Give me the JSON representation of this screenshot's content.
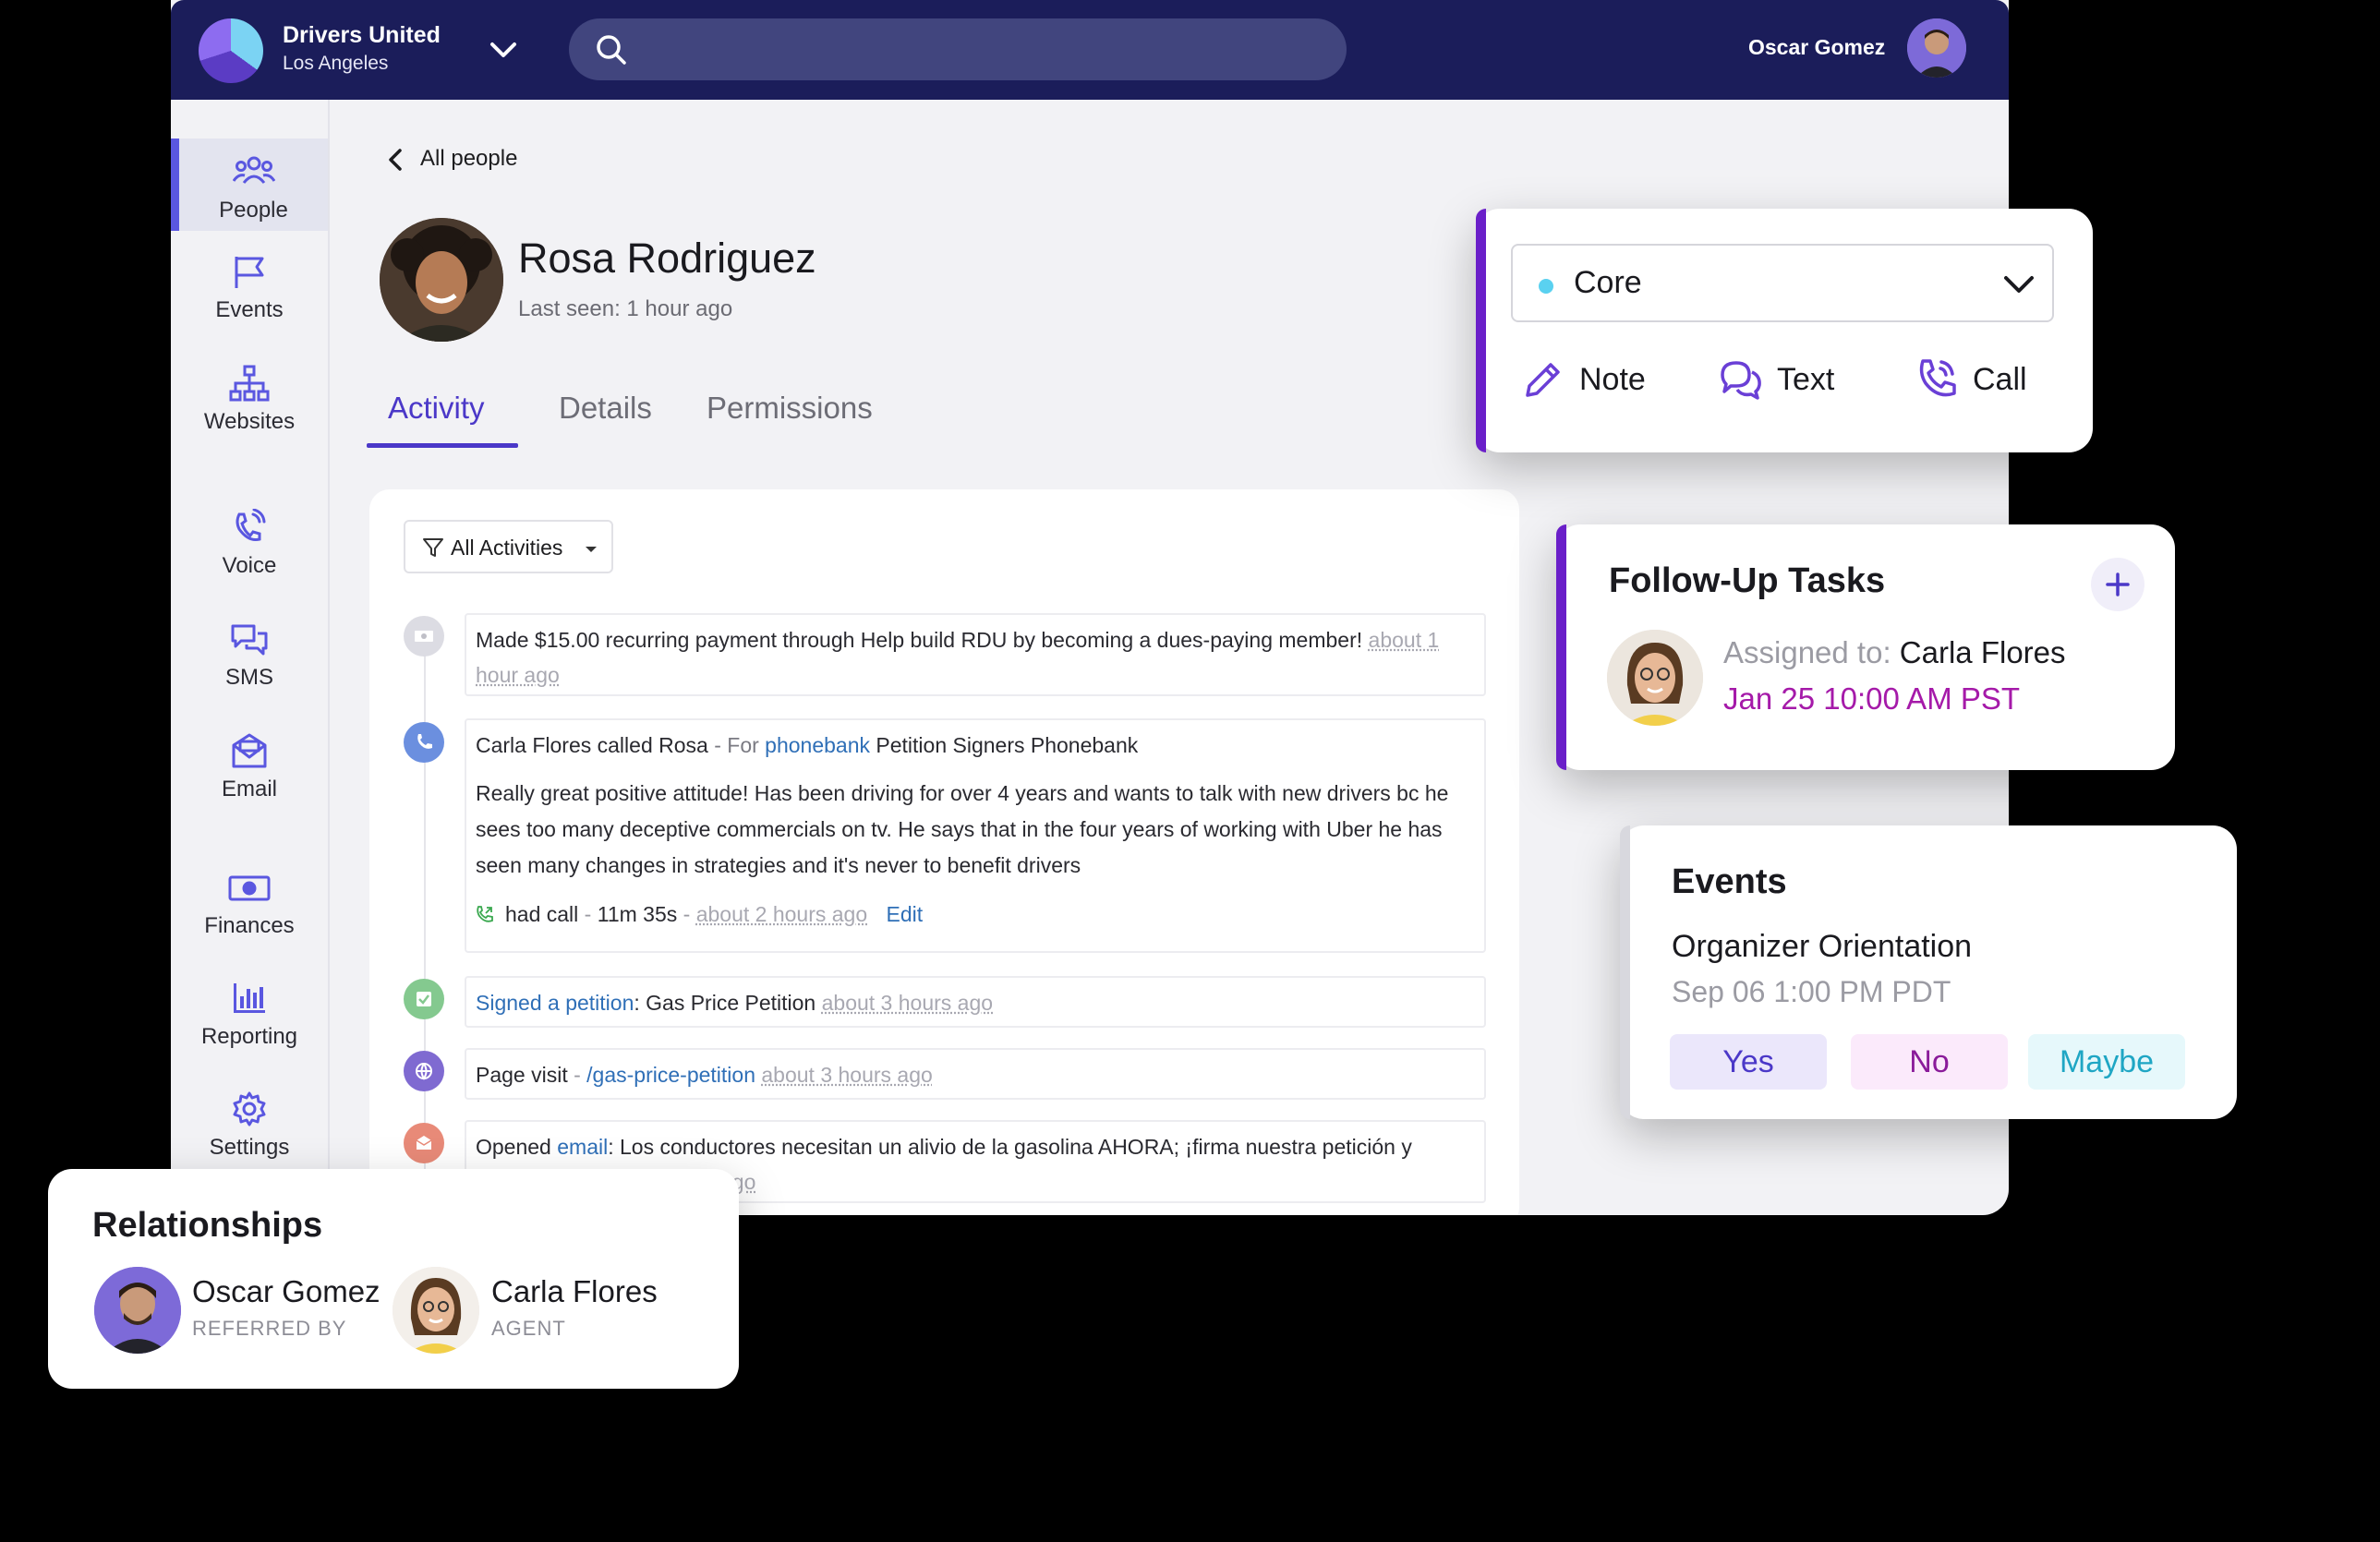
{
  "org": {
    "name": "Drivers United",
    "city": "Los Angeles"
  },
  "header": {
    "user_name": "Oscar Gomez",
    "search_placeholder": ""
  },
  "sidebar": {
    "items": [
      {
        "label": "People",
        "icon": "people-icon"
      },
      {
        "label": "Events",
        "icon": "flag-icon"
      },
      {
        "label": "Websites",
        "icon": "sitemap-icon"
      },
      {
        "label": "Voice",
        "icon": "phone-icon"
      },
      {
        "label": "SMS",
        "icon": "chat-icon"
      },
      {
        "label": "Email",
        "icon": "mail-icon"
      },
      {
        "label": "Finances",
        "icon": "money-icon"
      },
      {
        "label": "Reporting",
        "icon": "bar-chart-icon"
      },
      {
        "label": "Settings",
        "icon": "gear-icon"
      }
    ]
  },
  "person": {
    "back_label": "All people",
    "name": "Rosa Rodriguez",
    "last_seen": "Last seen: 1 hour ago"
  },
  "tabs": [
    "Activity",
    "Details",
    "Permissions"
  ],
  "activity": {
    "filter_label": "All Activities",
    "items": [
      {
        "text": "Made $15.00 recurring payment through Help build RDU by becoming a dues-paying member!",
        "time": "about 1 hour ago"
      },
      {
        "caller": "Carla Flores called  Rosa",
        "for_prefix": "- For",
        "for_link": "phonebank",
        "campaign": "Petition Signers Phonebank",
        "note": "Really great positive attitude! Has been driving for over 4 years and wants to talk with new drivers bc he sees too many deceptive commercials on tv. He says that in the four years of working with Uber he has seen many changes in strategies and it's never to benefit drivers",
        "result": "had call",
        "duration": "11m 35s",
        "time": "about 2 hours ago",
        "edit": "Edit"
      },
      {
        "link": "Signed a petition",
        "text": ": Gas Price Petition",
        "time": "about 3 hours ago"
      },
      {
        "text": "Page visit",
        "link": "/gas-price-petition",
        "time": "about 3 hours ago"
      },
      {
        "prefix": "Opened",
        "link": "email",
        "text": ": Los conductores necesitan un alivio de la gasolina AHORA; ¡firma nuestra petición y",
        "time": "ago"
      }
    ]
  },
  "quick_actions": {
    "list_name": "Core",
    "note": "Note",
    "text": "Text",
    "call": "Call"
  },
  "tasks": {
    "title": "Follow-Up Tasks",
    "assigned_label": "Assigned to:",
    "assignee": "Carla Flores",
    "due": "Jan 25 10:00 AM PST"
  },
  "events": {
    "title": "Events",
    "name": "Organizer Orientation",
    "date": "Sep 06 1:00 PM PDT",
    "yes": "Yes",
    "no": "No",
    "maybe": "Maybe"
  },
  "relationships": {
    "title": "Relationships",
    "people": [
      {
        "name": "Oscar Gomez",
        "role": "REFERRED BY"
      },
      {
        "name": "Carla Flores",
        "role": "AGENT"
      }
    ]
  },
  "colors": {
    "topbar": "#1b1d5a",
    "accent": "#4b38c8",
    "stripe": "#6a1fc9",
    "task_date": "#a51aa9"
  }
}
